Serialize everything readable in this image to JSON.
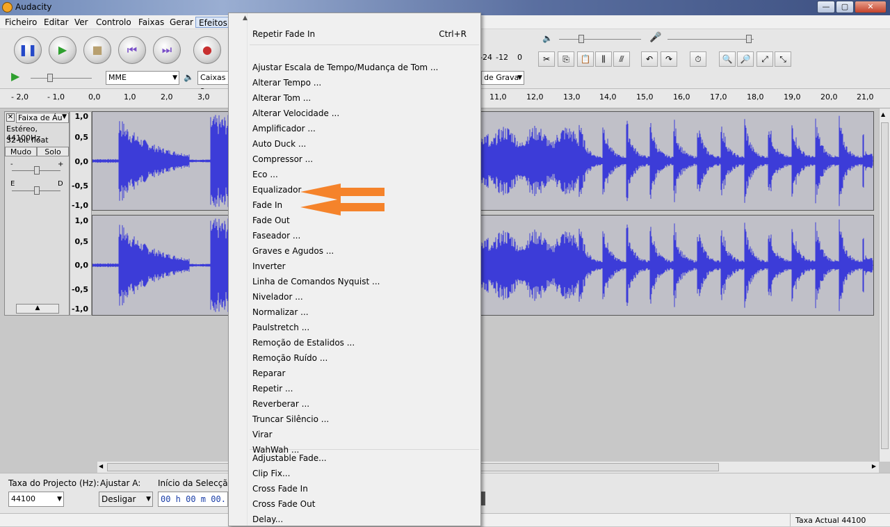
{
  "window": {
    "title": "Audacity",
    "minimize": "—",
    "maximize": "▢",
    "close": "✕"
  },
  "menubar": [
    "Ficheiro",
    "Editar",
    "Ver",
    "Controlo",
    "Faixas",
    "Gerar",
    "Efeitos"
  ],
  "toolbar": {
    "host": "MME",
    "output_device": "Caixas a",
    "input_device": "de Grava",
    "meter_ticks": [
      "-24",
      "-12",
      "0"
    ]
  },
  "ruler": {
    "ticks": [
      "- 2,0",
      "- 1,0",
      "0,0",
      "1,0",
      "2,0",
      "3,0",
      "11,0",
      "12,0",
      "13,0",
      "14,0",
      "15,0",
      "16,0",
      "17,0",
      "18,0",
      "19,0",
      "20,0",
      "21,0"
    ]
  },
  "track": {
    "name": "Faixa de Áu",
    "format": "Estéreo, 44100Hz",
    "bitdepth": "32-bit float",
    "mute": "Mudo",
    "solo": "Solo",
    "gain_minus": "-",
    "gain_plus": "+",
    "pan_left": "E",
    "pan_right": "D",
    "scale": [
      "1,0",
      "0,5",
      "0,0",
      "-0,5",
      "-1,0"
    ]
  },
  "bottom": {
    "project_rate_label": "Taxa do Projecto (Hz):",
    "project_rate": "44100",
    "snap_label": "Ajustar A:",
    "snap": "Desligar",
    "selection_label": "Início da Selecção",
    "selection_value": "00 h 00 m 00."
  },
  "status": {
    "rate": "Taxa Actual 44100"
  },
  "effects_menu": {
    "scroll_up": "▲",
    "repeat": {
      "label": "Repetir Fade In",
      "shortcut": "Ctrl+R"
    },
    "items": [
      "Ajustar Escala de Tempo/Mudança de Tom ...",
      "Alterar Tempo ...",
      "Alterar Tom ...",
      "Alterar Velocidade ...",
      "Amplificador ...",
      "Auto Duck ...",
      "Compressor ...",
      "Eco ...",
      "Equalizador ...",
      "Fade In",
      "Fade Out",
      "Faseador ...",
      "Graves e Agudos ...",
      "Inverter",
      "Linha de Comandos Nyquist ...",
      "Nivelador ...",
      "Normalizar ...",
      "Paulstretch ...",
      "Remoção de Estalidos ...",
      "Remoção Ruído ...",
      "Reparar",
      "Repetir ...",
      "Reverberar ...",
      "Truncar Silêncio ...",
      "Virar",
      "WahWah ..."
    ],
    "plugins": [
      "Adjustable Fade...",
      "Clip Fix...",
      "Cross Fade In",
      "Cross Fade Out",
      "Delay..."
    ]
  },
  "colors": {
    "wave": "#3c3cd8",
    "arrow": "#f5832b",
    "wave_bg": "#c0c0c8"
  }
}
